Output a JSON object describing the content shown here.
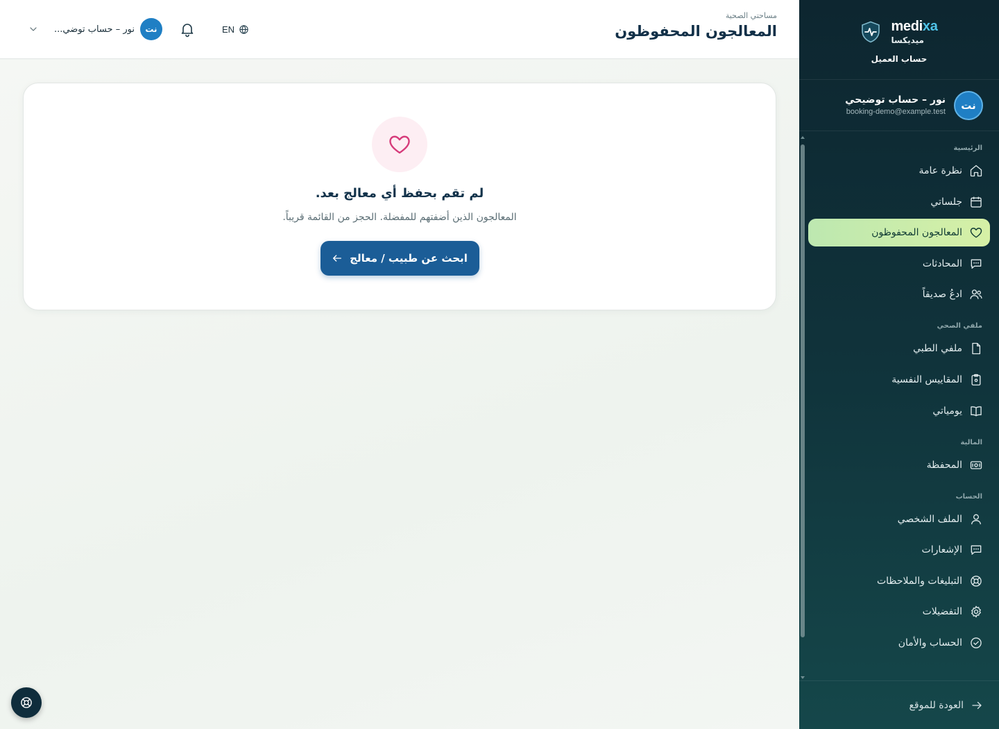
{
  "brand": {
    "latin_main": "medi",
    "latin_accent": "xa",
    "arabic": "ميديكسا",
    "subtitle": "حساب العميل"
  },
  "account": {
    "initials": "نت",
    "name": "نور – حساب توضيحي",
    "email": "booking-demo@example.test"
  },
  "sidebar": {
    "sections": [
      {
        "title": "الرئيسية",
        "items": [
          {
            "label": "نظرة عامة",
            "icon": "home-icon"
          },
          {
            "label": "جلساتي",
            "icon": "calendar-icon"
          },
          {
            "label": "المعالجون المحفوظون",
            "icon": "heart-icon",
            "active": true
          },
          {
            "label": "المحادثات",
            "icon": "chat-icon"
          },
          {
            "label": "ادعُ صديقاً",
            "icon": "users-icon"
          }
        ]
      },
      {
        "title": "ملفي الصحي",
        "items": [
          {
            "label": "ملفي الطبي",
            "icon": "file-icon"
          },
          {
            "label": "المقاييس النفسية",
            "icon": "clipboard-icon"
          },
          {
            "label": "يومياتي",
            "icon": "book-icon"
          }
        ]
      },
      {
        "title": "المالية",
        "items": [
          {
            "label": "المحفظة",
            "icon": "wallet-icon"
          }
        ]
      },
      {
        "title": "الحساب",
        "items": [
          {
            "label": "الملف الشخصي",
            "icon": "user-icon"
          },
          {
            "label": "الإشعارات",
            "icon": "message-icon"
          },
          {
            "label": "التبليغات والملاحظات",
            "icon": "lifebuoy-icon"
          },
          {
            "label": "التفضيلات",
            "icon": "gear-icon"
          },
          {
            "label": "الحساب والأمان",
            "icon": "check-circle-icon"
          }
        ]
      }
    ],
    "back_link": "العودة للموقع"
  },
  "header": {
    "eyebrow": "مساحتي الصحية",
    "title": "المعالجون المحفوظون",
    "user_chip_name": "نور – حساب توضي...",
    "language": "EN"
  },
  "empty_state": {
    "title": "لم تقم بحفظ أي معالج بعد.",
    "description": "المعالجون الذين أضفتهم للمفضلة. الحجز من القائمة قريباً.",
    "cta_label": "ابحث عن طبيب / معالج"
  },
  "colors": {
    "sidebar_bg": "#0d2630",
    "active_item": "#c8ecaa",
    "primary": "#1b5d97",
    "heart": "#d63b7a",
    "accent": "#4fc3e8"
  }
}
